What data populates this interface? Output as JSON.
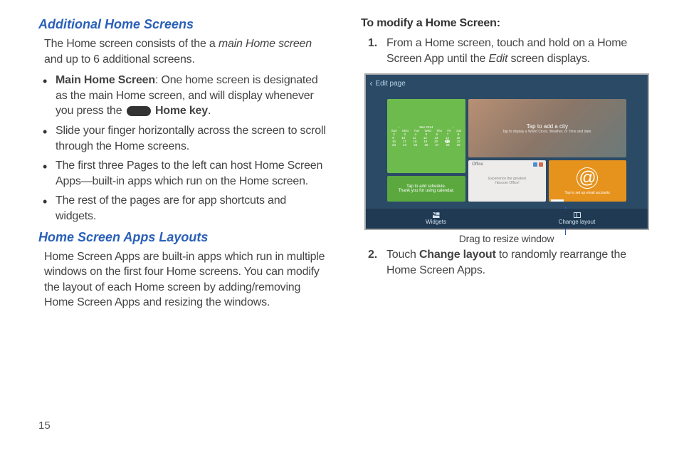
{
  "left": {
    "heading1": "Additional Home Screens",
    "intro_a": "The Home screen consists of the a ",
    "intro_b": "main Home screen",
    "intro_c": " and up to 6 additional screens.",
    "bullet1_a": "Main Home Screen",
    "bullet1_b": ": One home screen is designated as the main Home screen, and will display whenever you press the ",
    "bullet1_c": "Home key",
    "bullet1_d": ".",
    "bullet2": "Slide your finger horizontally across the screen to scroll through the Home screens.",
    "bullet3": "The first three Pages to the left can host Home Screen Apps—built-in apps which run on the Home screen.",
    "bullet4": "The rest of the pages are for app shortcuts and widgets.",
    "heading2": "Home Screen Apps Layouts",
    "body2": "Home Screen Apps are built-in apps which run in multiple windows on the first four Home screens. You can modify the layout of each Home screen by adding/removing Home Screen Apps and resizing the windows."
  },
  "right": {
    "heading": "To modify a Home Screen:",
    "step1_a": "From a Home screen, touch and hold on a Home Screen App until the ",
    "step1_b": "Edit",
    "step1_c": " screen displays.",
    "step2_a": "Touch ",
    "step2_b": "Change layout",
    "step2_c": " to randomly rearrange the Home Screen Apps.",
    "step1_num": "1.",
    "step2_num": "2.",
    "caption": "Drag to resize window"
  },
  "screenshot": {
    "edit_page": "Edit page",
    "cal_month": "Mar 2014",
    "cal_days": [
      "Sun",
      "Mon",
      "Tue",
      "Wed",
      "Thu",
      "Fri",
      "Sat"
    ],
    "cal_week1": [
      "",
      "",
      "",
      "",
      "",
      "",
      "1"
    ],
    "cal_week2": [
      "2",
      "3",
      "4",
      "5",
      "6",
      "7",
      "8"
    ],
    "cal_week3": [
      "9",
      "10",
      "11",
      "12",
      "13",
      "14",
      "15"
    ],
    "cal_week4": [
      "16",
      "17",
      "18",
      "19",
      "20",
      "21",
      "22"
    ],
    "cal_week5": [
      "23",
      "24",
      "25",
      "26",
      "27",
      "28",
      "29"
    ],
    "schedule_a": "Tap to add schedule.",
    "schedule_b": "Thank you for using calendar.",
    "city_a": "Tap to add a city",
    "city_b": "Tap to display a World Clock, Weather, or Time and date.",
    "office_label": "Office",
    "office_a": "Experience the greatest",
    "office_b": "Hancom Office!",
    "email_sub": "Tap to set up email accounts",
    "widgets": "Widgets",
    "change_layout": "Change layout"
  },
  "page_number": "15"
}
